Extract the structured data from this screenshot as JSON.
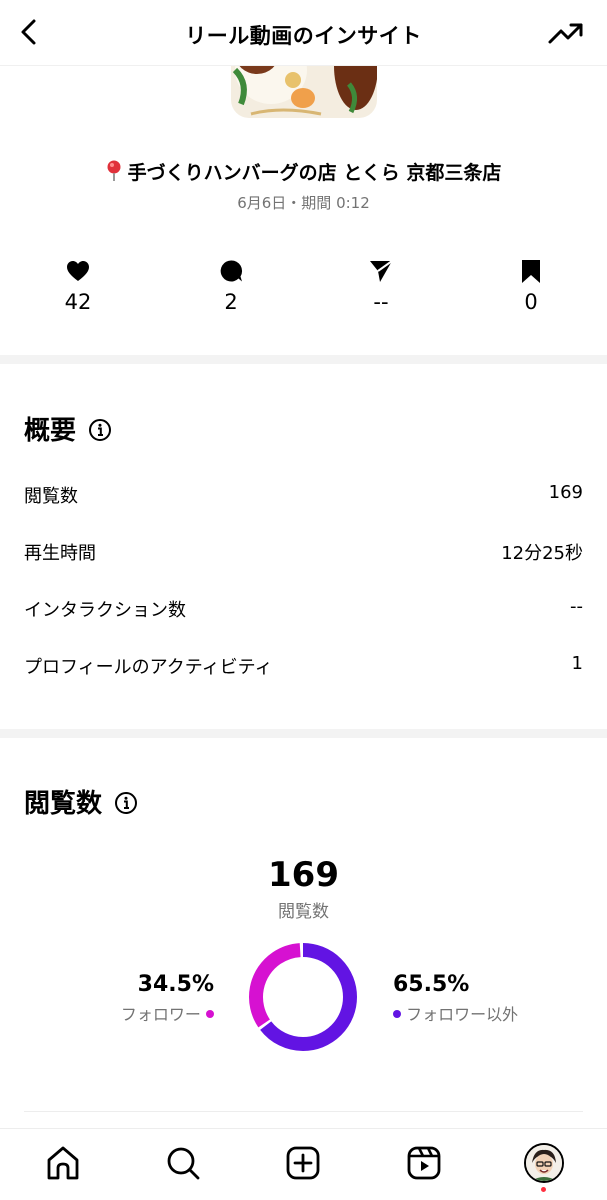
{
  "header": {
    "title": "リール動画のインサイト",
    "back_icon": "chevron-left-icon",
    "trend_icon": "trending-up-icon"
  },
  "post": {
    "location": "手づくりハンバーグの店 とくら 京都三条店",
    "meta": "6月6日・期間 0:12"
  },
  "stats": [
    {
      "icon": "heart-icon",
      "value": "42"
    },
    {
      "icon": "comment-icon",
      "value": "2"
    },
    {
      "icon": "share-icon",
      "value": "--"
    },
    {
      "icon": "bookmark-icon",
      "value": "0"
    }
  ],
  "overview": {
    "title": "概要",
    "rows": [
      {
        "label": "閲覧数",
        "value": "169"
      },
      {
        "label": "再生時間",
        "value": "12分25秒"
      },
      {
        "label": "インタラクション数",
        "value": "--"
      },
      {
        "label": "プロフィールのアクティビティ",
        "value": "1"
      }
    ]
  },
  "views": {
    "title": "閲覧数",
    "total": "169",
    "total_label": "閲覧数",
    "followers_pct": "34.5%",
    "followers_label": "フォロワー",
    "non_followers_pct": "65.5%",
    "non_followers_label": "フォロワー以外",
    "followers_fraction": 0.345,
    "colors": {
      "followers": "#d611d1",
      "non_followers": "#6214e3"
    }
  },
  "nav": {
    "items": [
      "home-icon",
      "search-icon",
      "create-icon",
      "reels-icon",
      "profile-avatar"
    ]
  }
}
